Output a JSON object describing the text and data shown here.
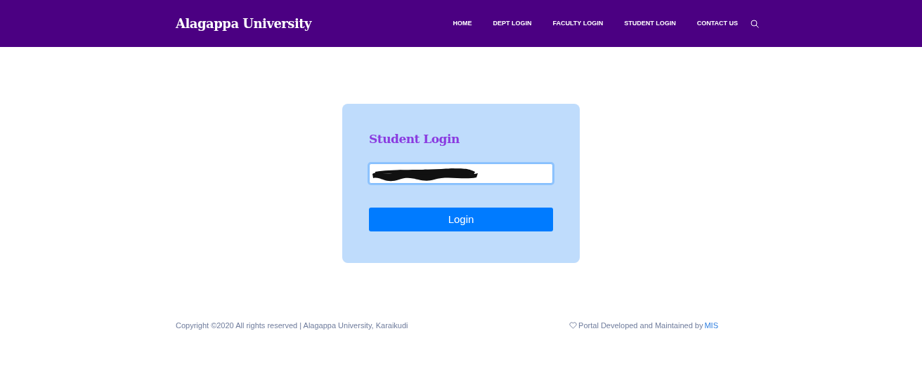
{
  "navbar": {
    "brand": "Alagappa University",
    "links": [
      {
        "label": "HOME"
      },
      {
        "label": "DEPT LOGIN"
      },
      {
        "label": "FACULTY LOGIN"
      },
      {
        "label": "STUDENT LOGIN"
      },
      {
        "label": "CONTACT US"
      }
    ]
  },
  "login_card": {
    "title": "Student Login",
    "field": {
      "focused": true,
      "value_redacted": true
    },
    "button": "Login"
  },
  "footer": {
    "copyright": "Copyright ©2020 All rights reserved | Alagappa University, Karaikudi",
    "credit": "Portal Developed and Maintained by",
    "credit_link": "MIS"
  }
}
